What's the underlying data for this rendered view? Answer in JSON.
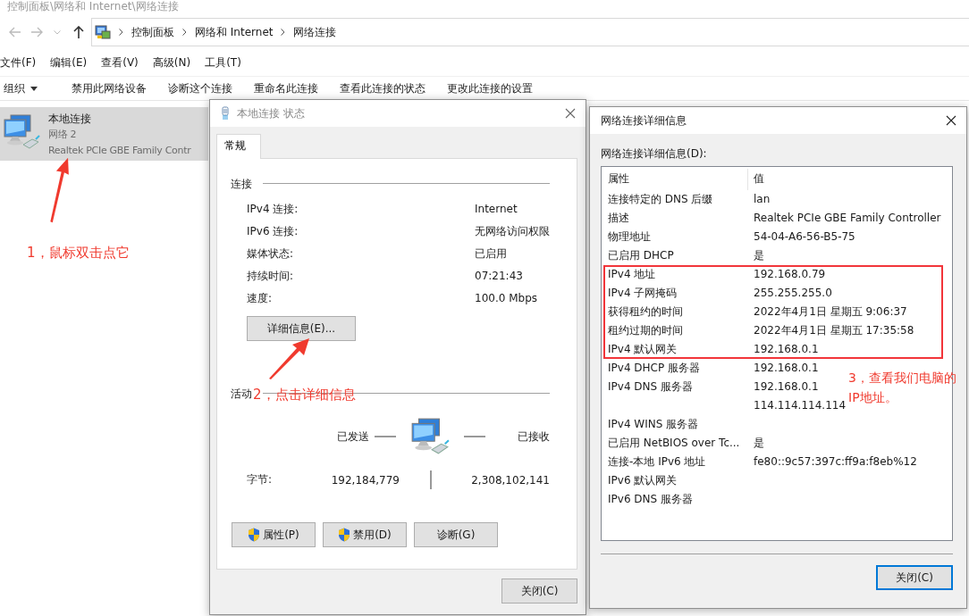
{
  "explorer": {
    "path_title": "控制面板\\网络和 Internet\\网络连接",
    "breadcrumb": [
      "控制面板",
      "网络和 Internet",
      "网络连接"
    ],
    "menu": [
      "文件(F)",
      "编辑(E)",
      "查看(V)",
      "高级(N)",
      "工具(T)"
    ],
    "toolbar": [
      {
        "label": "组织",
        "kind": "dropdown"
      },
      {
        "label": "禁用此网络设备",
        "kind": "command"
      },
      {
        "label": "诊断这个连接",
        "kind": "command"
      },
      {
        "label": "重命名此连接",
        "kind": "command"
      },
      {
        "label": "查看此连接的状态",
        "kind": "command"
      },
      {
        "label": "更改此连接的设置",
        "kind": "command"
      }
    ],
    "connections": [
      {
        "name": "本地连接",
        "network": "网络 2",
        "adapter": "Realtek PCIe GBE Family Contr",
        "selected": true
      }
    ]
  },
  "status_dialog": {
    "title": "本地连接 状态",
    "tabs": [
      {
        "label": "常规",
        "selected": true
      }
    ],
    "connection_heading": "连接",
    "fields": [
      {
        "label": "IPv4 连接:",
        "value": "Internet"
      },
      {
        "label": "IPv6 连接:",
        "value": "无网络访问权限"
      },
      {
        "label": "媒体状态:",
        "value": "已启用"
      },
      {
        "label": "持续时间:",
        "value": "07:21:43"
      },
      {
        "label": "速度:",
        "value": "100.0 Mbps"
      }
    ],
    "details_button": "详细信息(E)...",
    "activity_heading": "活动",
    "sent_label": "已发送",
    "received_label": "已接收",
    "bytes_label": "字节:",
    "bytes_sent": "192,184,779",
    "bytes_received": "2,308,102,141",
    "buttons": [
      {
        "label": "属性(P)",
        "shield": true
      },
      {
        "label": "禁用(D)",
        "shield": true
      },
      {
        "label": "诊断(G)",
        "shield": false
      }
    ],
    "close_button": "关闭(C)"
  },
  "details_dialog": {
    "title": "网络连接详细信息",
    "list_label": "网络连接详细信息(D):",
    "columns": [
      "属性",
      "值"
    ],
    "rows": [
      {
        "property": "连接特定的 DNS 后缀",
        "values": [
          "lan"
        ]
      },
      {
        "property": "描述",
        "values": [
          "Realtek PCIe GBE Family Controller"
        ]
      },
      {
        "property": "物理地址",
        "values": [
          "54-04-A6-56-B5-75"
        ]
      },
      {
        "property": "已启用 DHCP",
        "values": [
          "是"
        ]
      },
      {
        "property": "IPv4 地址",
        "values": [
          "192.168.0.79"
        ]
      },
      {
        "property": "IPv4 子网掩码",
        "values": [
          "255.255.255.0"
        ]
      },
      {
        "property": "获得租约的时间",
        "values": [
          "2022年4月1日 星期五 9:06:37"
        ]
      },
      {
        "property": "租约过期的时间",
        "values": [
          "2022年4月1日 星期五 17:35:58"
        ]
      },
      {
        "property": "IPv4 默认网关",
        "values": [
          "192.168.0.1"
        ]
      },
      {
        "property": "IPv4 DHCP 服务器",
        "values": [
          "192.168.0.1"
        ]
      },
      {
        "property": "IPv4 DNS 服务器",
        "values": [
          "192.168.0.1",
          "114.114.114.114"
        ]
      },
      {
        "property": "IPv4 WINS 服务器",
        "values": []
      },
      {
        "property": "已启用 NetBIOS over Tc...",
        "values": [
          "是"
        ]
      },
      {
        "property": "连接-本地 IPv6 地址",
        "values": [
          "fe80::9c57:397c:ff9a:f8eb%12"
        ]
      },
      {
        "property": "IPv6 默认网关",
        "values": []
      },
      {
        "property": "IPv6 DNS 服务器",
        "values": []
      }
    ],
    "close_button": {
      "label": "关闭(C)",
      "focused": true
    }
  },
  "annotations": [
    {
      "text": "1，鼠标双击点它"
    },
    {
      "text": "2，点击详细信息"
    },
    {
      "text": "3，查看我们电脑的IP地址。"
    }
  ]
}
